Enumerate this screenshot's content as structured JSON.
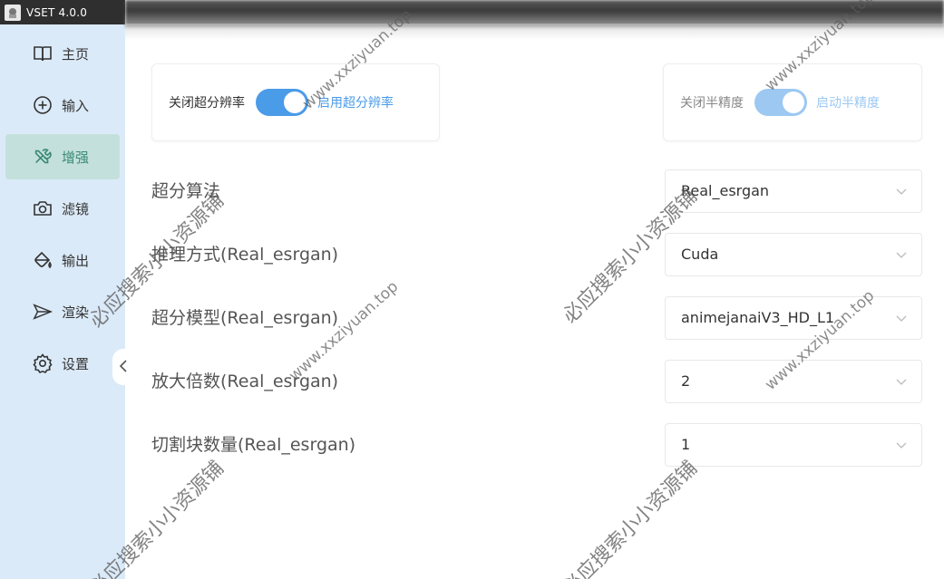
{
  "app": {
    "title": "VSET 4.0.0"
  },
  "sidebar": {
    "items": [
      {
        "label": "主页",
        "icon": "book-icon",
        "active": false
      },
      {
        "label": "输入",
        "icon": "plus-circle-icon",
        "active": false
      },
      {
        "label": "增强",
        "icon": "tools-icon",
        "active": true
      },
      {
        "label": "滤镜",
        "icon": "camera-icon",
        "active": false
      },
      {
        "label": "输出",
        "icon": "paint-bucket-icon",
        "active": false
      },
      {
        "label": "渲染",
        "icon": "send-icon",
        "active": false
      },
      {
        "label": "设置",
        "icon": "gear-icon",
        "active": false
      }
    ],
    "collapse_icon": "chevron-left-icon"
  },
  "toggles": {
    "super_resolution": {
      "off_label": "关闭超分辨率",
      "on_label": "启用超分辨率",
      "state": "on"
    },
    "half_precision": {
      "off_label": "关闭半精度",
      "on_label": "启动半精度",
      "state": "on",
      "disabled": true
    }
  },
  "settings": [
    {
      "label": "超分算法",
      "value": "Real_esrgan"
    },
    {
      "label": "推理方式(Real_esrgan)",
      "value": "Cuda"
    },
    {
      "label": "超分模型(Real_esrgan)",
      "value": "animejanaiV3_HD_L1"
    },
    {
      "label": "放大倍数(Real_esrgan)",
      "value": "2"
    },
    {
      "label": "切割块数量(Real_esrgan)",
      "value": "1"
    }
  ],
  "watermarks": {
    "url": "www.xxziyuan.top",
    "cn": "必应搜索小小资源铺"
  },
  "colors": {
    "sidebar_bg": "#dbeaf8",
    "active_bg": "#c4e0dc",
    "accent": "#4a9be8",
    "accent_disabled": "#9cc8f2"
  }
}
